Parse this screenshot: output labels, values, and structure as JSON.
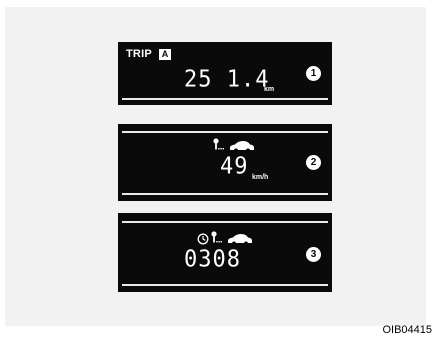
{
  "displays": [
    {
      "label": "TRIP",
      "badge": "A",
      "value": "25 1.4",
      "unit": "km",
      "number": "1",
      "icons": []
    },
    {
      "value": "49",
      "unit": "km/h",
      "number": "2",
      "icons": [
        "key-icon",
        "car-icon"
      ]
    },
    {
      "value": "0308",
      "number": "3",
      "icons": [
        "clock-icon",
        "key-icon",
        "car-icon"
      ]
    }
  ],
  "caption": "OIB04415",
  "colors": {
    "screen": "#0a0a0a",
    "text": "#ffffff",
    "panel": "#f2f2f2"
  }
}
